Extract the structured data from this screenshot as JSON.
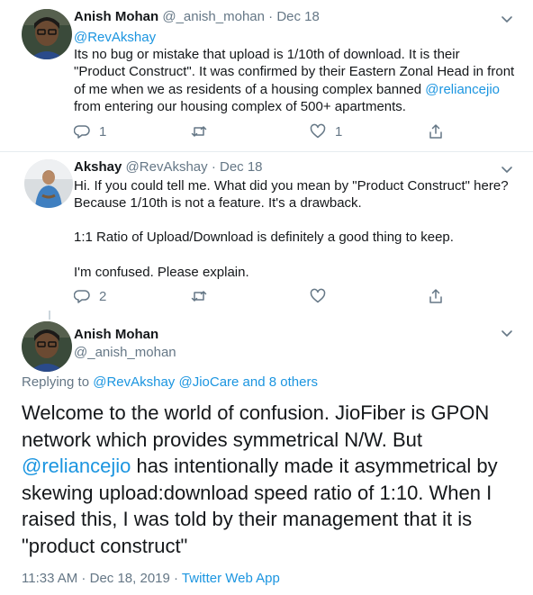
{
  "tweet1": {
    "name": "Anish Mohan",
    "handle": "@_anish_mohan",
    "separator": "·",
    "date": "Dec 18",
    "lines": [
      "@RevAkshay",
      "Its no bug or mistake that upload is 1/10th of download. It is their",
      "\"Product Construct\". It was confirmed by their Eastern Zonal Head in front",
      "of me when we as residents of a housing complex banned ",
      "from entering our housing complex of 500+ apartments."
    ],
    "mention_inline": "@reliancejio",
    "reply_count": "1",
    "like_count": "1"
  },
  "tweet2": {
    "name": "Akshay",
    "handle": "@RevAkshay",
    "separator": "·",
    "date": "Dec 18",
    "lines": [
      "Hi. If you could tell me. What did you mean by \"Product Construct\" here?",
      "Because 1/10th is not a feature. It's a drawback.",
      "1:1 Ratio of Upload/Download is definitely a good thing to keep.",
      "I'm confused. Please explain."
    ],
    "reply_count": "2"
  },
  "tweet3": {
    "name": "Anish Mohan",
    "handle": "@_anish_mohan",
    "replying_prefix": "Replying to ",
    "replying_mentions": "@RevAkshay @JioCare and 8 others",
    "lines": [
      "Welcome to the world of confusion. JioFiber is GPON",
      "network which provides symmetrical N/W. But",
      " has intentionally made it asymmetrical by",
      "skewing upload:download speed ratio of 1:10. When I",
      "raised this, I was told by their management that it is",
      "\"product construct\""
    ],
    "mention_inline": "@reliancejio",
    "time": "11:33 AM",
    "meta_sep": " · ",
    "date": "Dec 18, 2019",
    "source": "Twitter Web App"
  },
  "icons": {
    "reply": "reply-icon",
    "retweet": "retweet-icon",
    "like": "like-icon",
    "share": "share-icon",
    "more": "chevron-down-icon"
  },
  "colors": {
    "link": "#1b95e0",
    "muted": "#657786",
    "text": "#14171a",
    "divider": "#e6ecf0",
    "thread_line": "#ccd6dd"
  }
}
